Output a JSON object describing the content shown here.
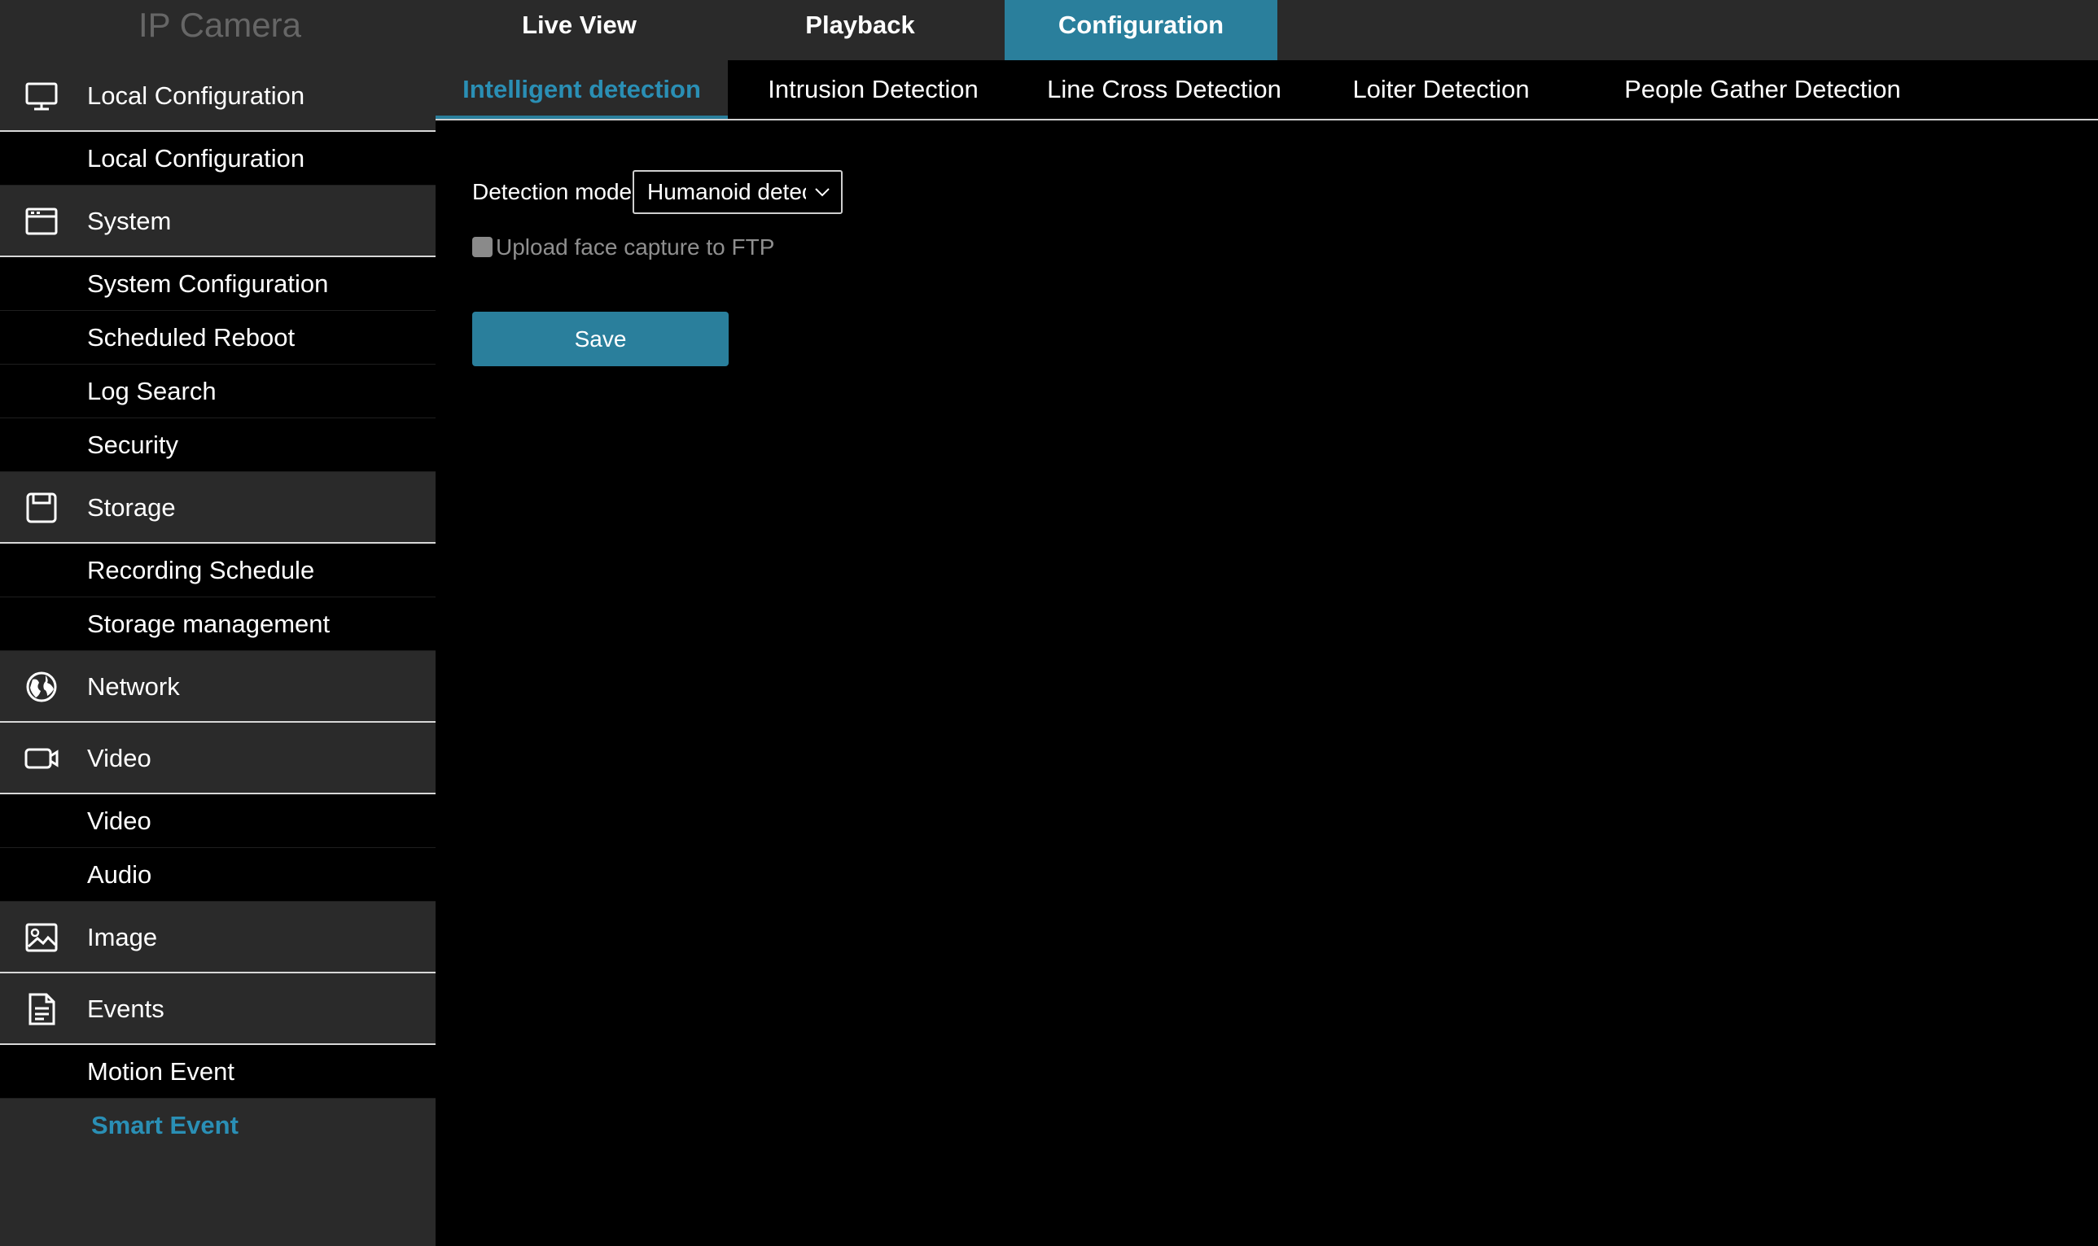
{
  "app": {
    "title": "IP Camera"
  },
  "top_nav": [
    {
      "label": "Live View",
      "active": false
    },
    {
      "label": "Playback",
      "active": false
    },
    {
      "label": "Configuration",
      "active": true
    }
  ],
  "sidebar": [
    {
      "type": "category",
      "label": "Local Configuration",
      "icon": "monitor-icon"
    },
    {
      "type": "sub",
      "label": "Local Configuration"
    },
    {
      "type": "category",
      "label": "System",
      "icon": "window-icon"
    },
    {
      "type": "sub",
      "label": "System Configuration"
    },
    {
      "type": "sub",
      "label": "Scheduled Reboot"
    },
    {
      "type": "sub",
      "label": "Log Search"
    },
    {
      "type": "sub",
      "label": "Security"
    },
    {
      "type": "category",
      "label": "Storage",
      "icon": "floppy-disk-icon"
    },
    {
      "type": "sub",
      "label": "Recording Schedule"
    },
    {
      "type": "sub",
      "label": "Storage management"
    },
    {
      "type": "category",
      "label": "Network",
      "icon": "globe-icon"
    },
    {
      "type": "category",
      "label": "Video",
      "icon": "video-camera-icon"
    },
    {
      "type": "sub",
      "label": "Video"
    },
    {
      "type": "sub",
      "label": "Audio"
    },
    {
      "type": "category",
      "label": "Image",
      "icon": "image-icon"
    },
    {
      "type": "category",
      "label": "Events",
      "icon": "document-icon"
    },
    {
      "type": "sub",
      "label": "Motion Event"
    },
    {
      "type": "sub",
      "label": "Smart Event",
      "active": true
    }
  ],
  "sub_tabs": [
    {
      "label": "Intelligent detection",
      "active": true
    },
    {
      "label": "Intrusion Detection"
    },
    {
      "label": "Line Cross Detection"
    },
    {
      "label": "Loiter Detection"
    },
    {
      "label": "People Gather Detection"
    }
  ],
  "form": {
    "detection_mode_label": "Detection mode",
    "detection_mode_value": "Humanoid detection",
    "upload_face_label": "Upload face capture to FTP",
    "upload_face_checked": false,
    "save_label": "Save"
  },
  "colors": {
    "accent": "#2a7f9c",
    "accent_text": "#2a8fb5",
    "panel": "#2a2a2a",
    "background": "#000000"
  }
}
